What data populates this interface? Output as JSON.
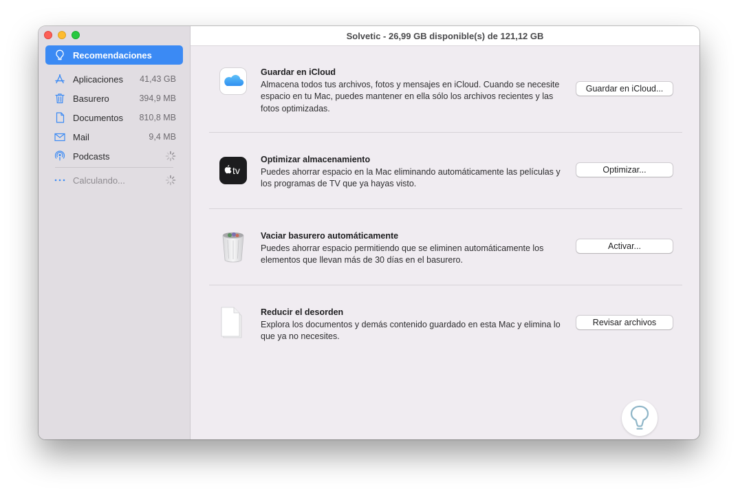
{
  "window": {
    "title": "Solvetic - 26,99 GB disponible(s) de 121,12 GB"
  },
  "sidebar": {
    "selected": {
      "label": "Recomendaciones",
      "icon": "lightbulb-icon"
    },
    "items": [
      {
        "label": "Aplicaciones",
        "size": "41,43 GB",
        "icon": "app-store-icon"
      },
      {
        "label": "Basurero",
        "size": "394,9 MB",
        "icon": "trash-icon"
      },
      {
        "label": "Documentos",
        "size": "810,8 MB",
        "icon": "document-icon"
      },
      {
        "label": "Mail",
        "size": "9,4 MB",
        "icon": "envelope-icon"
      },
      {
        "label": "Podcasts",
        "size": "",
        "icon": "podcast-icon"
      }
    ],
    "calculating": {
      "label": "Calculando...",
      "icon": "ellipsis-icon"
    }
  },
  "recommendations": [
    {
      "title": "Guardar en iCloud",
      "description": "Almacena todos tus archivos, fotos y mensajes en iCloud. Cuando se necesite espacio en tu Mac, puedes mantener en ella sólo los archivos recientes y las fotos optimizadas.",
      "button": "Guardar en iCloud...",
      "icon": "icloud-icon"
    },
    {
      "title": "Optimizar almacenamiento",
      "description": "Puedes ahorrar espacio en la Mac eliminando automáticamente las películas y los programas de TV que ya hayas visto.",
      "button": "Optimizar...",
      "icon": "apple-tv-icon",
      "icon_text": "tv"
    },
    {
      "title": "Vaciar basurero automáticamente",
      "description": "Puedes ahorrar espacio permitiendo que se eliminen automáticamente los elementos que llevan más de 30 días en el basurero.",
      "button": "Activar...",
      "icon": "full-trash-icon"
    },
    {
      "title": "Reducir el desorden",
      "description": "Explora los documentos y demás contenido guardado en esta Mac y elimina lo que ya no necesites.",
      "button": "Revisar archivos",
      "icon": "documents-stack-icon"
    }
  ],
  "colors": {
    "accent": "#3b8af4",
    "sidebar_bg": "#e1dde2",
    "content_bg": "#f0ecf1"
  }
}
